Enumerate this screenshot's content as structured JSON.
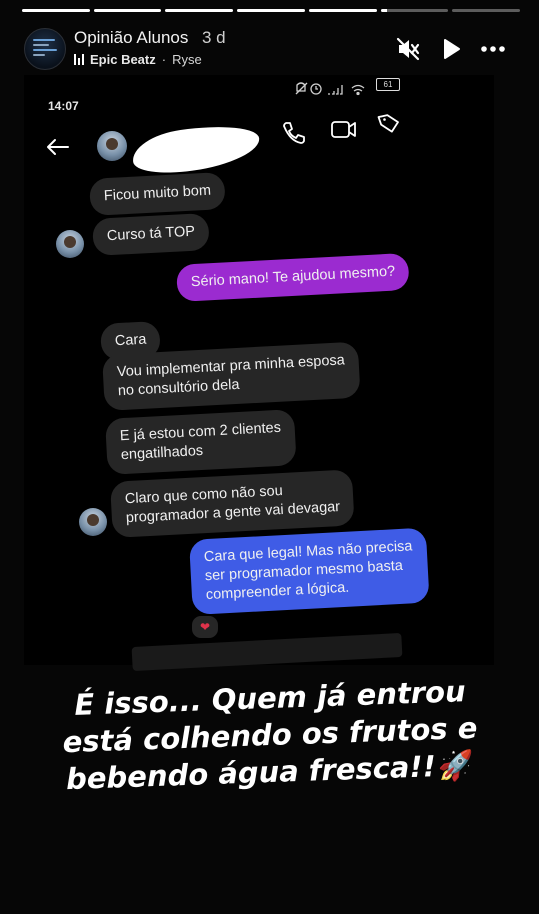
{
  "story": {
    "progress": {
      "segments": 7,
      "completed": 5,
      "current_fraction": 0.1
    },
    "account_name": "Opinião Alunos",
    "age": "3 d",
    "music": {
      "song": "Epic Beatz",
      "separator": "·",
      "artist": "Ryse"
    },
    "icons": {
      "mute": "muted-speaker-icon",
      "play": "play-icon",
      "more": "more-options-icon"
    }
  },
  "screenshot": {
    "status_time": "14:07",
    "battery": "61",
    "chat_icons": [
      "back-arrow-icon",
      "phone-icon",
      "video-camera-icon",
      "tag-icon"
    ],
    "messages": [
      {
        "text": "Ficou muito bom",
        "from": "them"
      },
      {
        "text": "Curso tá TOP",
        "from": "them"
      },
      {
        "text": "Sério mano! Te ajudou mesmo?",
        "from": "me"
      },
      {
        "text": "Cara",
        "from": "them"
      },
      {
        "lines": [
          "Vou implementar pra minha esposa",
          "no consultório dela"
        ],
        "from": "them"
      },
      {
        "lines": [
          "E já estou com 2 clientes",
          "engatilhados"
        ],
        "from": "them"
      },
      {
        "lines": [
          "Claro que como não sou",
          "programador a gente vai devagar"
        ],
        "from": "them"
      },
      {
        "lines": [
          "Cara que legal! Mas não precisa",
          "ser programador mesmo basta",
          "compreender a lógica."
        ],
        "from": "me"
      }
    ],
    "reaction": "❤",
    "colors": {
      "purple_bubble": "#9b2bd0",
      "blue_bubble": "#3f5ce6",
      "received_bubble": "#262626"
    }
  },
  "caption": {
    "line1": "É isso... Quem já entrou",
    "line2": "está colhendo os frutos e",
    "line3": "bebendo água fresca!!",
    "emoji": "🚀"
  }
}
